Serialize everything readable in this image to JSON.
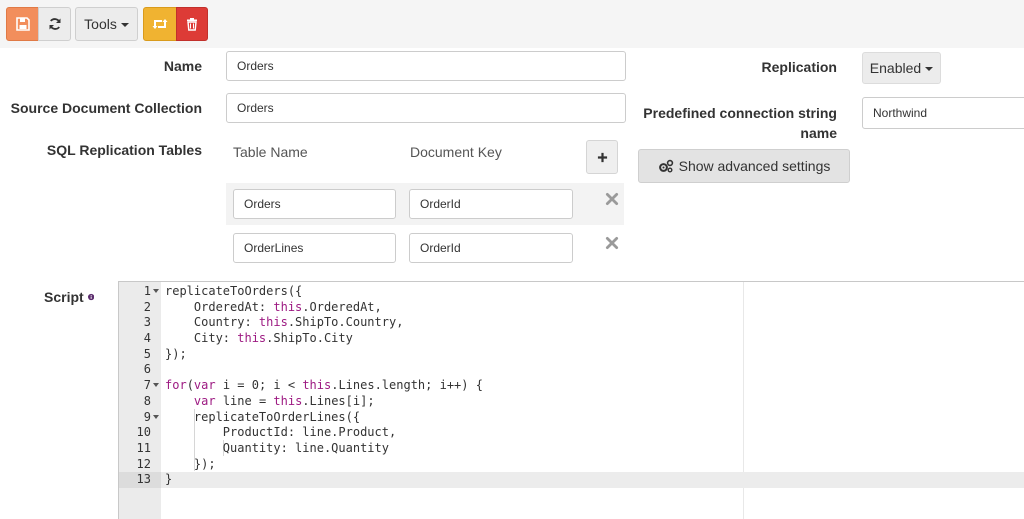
{
  "toolbar": {
    "tools_label": "Tools"
  },
  "form": {
    "name_label": "Name",
    "name_value": "Orders",
    "source_label": "Source Document Collection",
    "source_value": "Orders",
    "tables_label": "SQL Replication Tables",
    "table_name_header": "Table Name",
    "document_key_header": "Document Key",
    "tables": [
      {
        "table_name": "Orders",
        "document_key": "OrderId"
      },
      {
        "table_name": "OrderLines",
        "document_key": "OrderId"
      }
    ],
    "replication_label": "Replication",
    "replication_value": "Enabled",
    "connection_label": "Predefined connection string name",
    "connection_value": "Northwind",
    "advanced_label": "Show advanced settings",
    "script_label": "Script"
  },
  "editor": {
    "active_line": 13,
    "lines": [
      {
        "n": "1",
        "fold": true,
        "code": "replicateToOrders({"
      },
      {
        "n": "2",
        "fold": false,
        "code": "    OrderedAt: this.OrderedAt,"
      },
      {
        "n": "3",
        "fold": false,
        "code": "    Country: this.ShipTo.Country,"
      },
      {
        "n": "4",
        "fold": false,
        "code": "    City: this.ShipTo.City"
      },
      {
        "n": "5",
        "fold": false,
        "code": "});"
      },
      {
        "n": "6",
        "fold": false,
        "code": ""
      },
      {
        "n": "7",
        "fold": true,
        "code": "for(var i = 0; i < this.Lines.length; i++) {"
      },
      {
        "n": "8",
        "fold": false,
        "code": "    var line = this.Lines[i];"
      },
      {
        "n": "9",
        "fold": true,
        "code": "    replicateToOrderLines({"
      },
      {
        "n": "10",
        "fold": false,
        "code": "        ProductId: line.Product,"
      },
      {
        "n": "11",
        "fold": false,
        "code": "        Quantity: line.Quantity"
      },
      {
        "n": "12",
        "fold": false,
        "code": "    });"
      },
      {
        "n": "13",
        "fold": false,
        "code": "}"
      }
    ]
  },
  "colors": {
    "save": "#f28e5c",
    "replicate": "#f0b331",
    "delete": "#dd3b36",
    "keyword": "#9d1a82",
    "info_icon": "#5c2d6e"
  },
  "icons": [
    "save-icon",
    "refresh-icon",
    "retweet-icon",
    "trash-icon",
    "plus-icon",
    "cogs-icon",
    "close-icon",
    "info-icon",
    "chevron-down-icon",
    "fold-arrow-icon"
  ]
}
